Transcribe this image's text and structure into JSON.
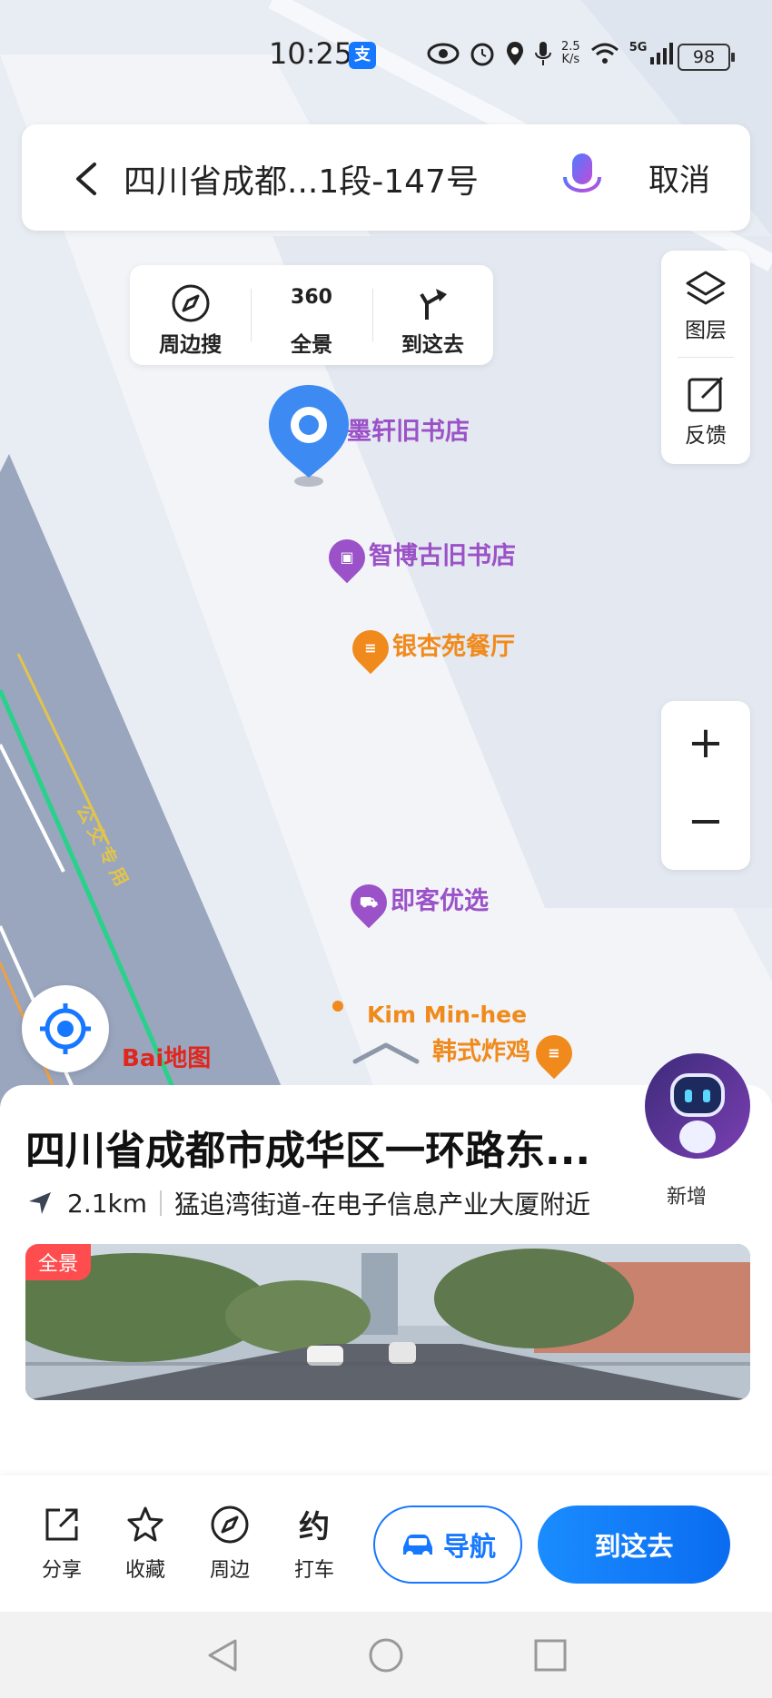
{
  "status_bar": {
    "time": "10:25",
    "alipay_icon_text": "支",
    "net_speed_value": "2.5",
    "net_speed_unit": "K/s",
    "signal_label": "5G",
    "battery": "98"
  },
  "search": {
    "query": "四川省成都...1段-147号",
    "cancel_label": "取消"
  },
  "quick_actions": [
    {
      "label": "周边搜",
      "icon": "compass-icon"
    },
    {
      "label": "全景",
      "icon": "panorama-360-icon",
      "icon_text": "360"
    },
    {
      "label": "到这去",
      "icon": "turn-arrow-icon"
    }
  ],
  "side_panel": {
    "layers_label": "图层",
    "feedback_label": "反馈"
  },
  "zoom": {
    "plus": "+",
    "minus": "−"
  },
  "map": {
    "pois": [
      {
        "name": "墨轩旧书店",
        "color": "#9b51c7"
      },
      {
        "name": "智博古旧书店",
        "color": "#9b51c7"
      },
      {
        "name": "银杏苑餐厅",
        "color": "#f08a1c"
      },
      {
        "name": "即客优选",
        "color": "#9b51c7"
      },
      {
        "name": "Kim Min-hee",
        "color": "#f08a1c"
      },
      {
        "name": "韩式炸鸡",
        "color": "#f08a1c"
      }
    ],
    "road_label": "公交专用",
    "logo_text": "Bai地图",
    "logo_paw": "du"
  },
  "assistant": {
    "label": "新增"
  },
  "place": {
    "title": "四川省成都市成华区一环路东...",
    "distance": "2.1km",
    "area": "猛追湾街道-在电子信息产业大厦附近",
    "streetview_badge": "全景"
  },
  "actions": {
    "share": "分享",
    "favorite": "收藏",
    "nearby": "周边",
    "taxi": "打车",
    "navigate": "导航",
    "go_here": "到这去"
  },
  "colors": {
    "accent": "#1677ff",
    "poi_purple": "#9b51c7",
    "poi_orange": "#f08a1c",
    "road": "#9aa6be",
    "bus_lane": "#2ad18a"
  }
}
